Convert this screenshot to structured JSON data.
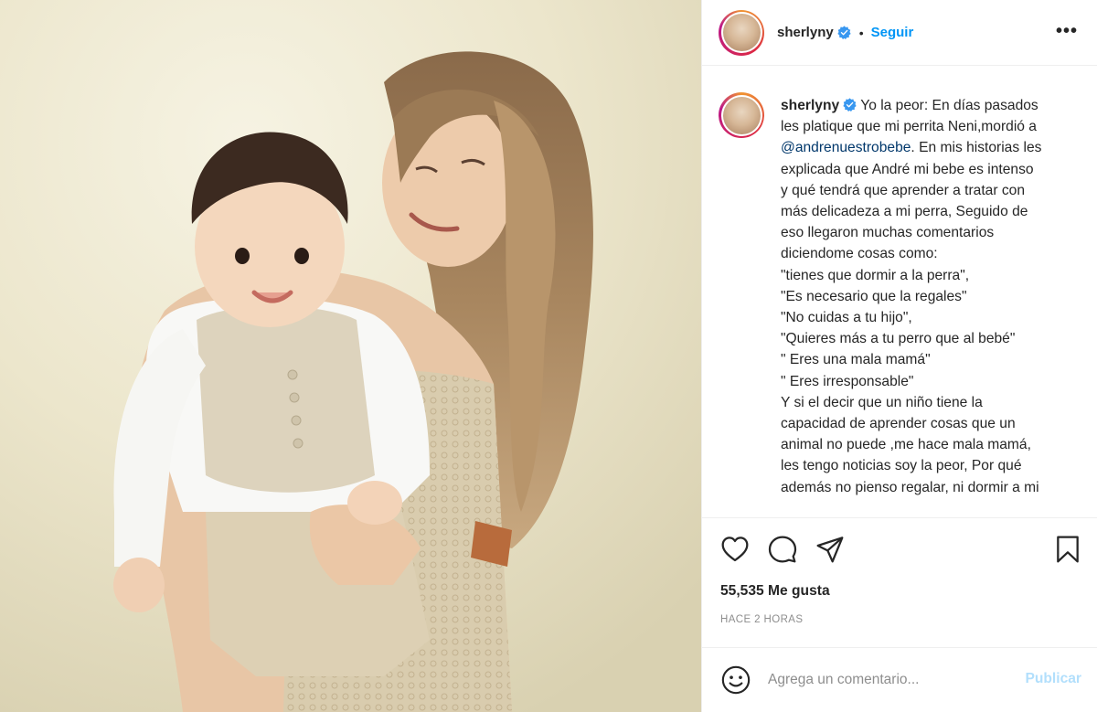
{
  "post": {
    "username": "sherlyny",
    "follow_label": "Seguir",
    "separator": "•",
    "more_label": "•••",
    "caption_username": "sherlyny",
    "caption_lines": [
      "Yo la peor: En días pasados",
      "les platique que mi perrita Neni,mordió a",
      "@andrenuestrobebe",
      ". En mis historias les",
      "explicada que André mi bebe es intenso",
      "y qué tendrá que aprender a tratar con",
      "más delicadeza a mi perra, Seguido de",
      "eso llegaron muchas comentarios",
      "diciendome cosas como:",
      "\"tienes que dormir a la perra\",",
      "\"Es necesario que la regales\"",
      "\"No cuidas a tu hijo\",",
      "\"Quieres más a tu perro que al bebé\"",
      "\" Eres una mala mamá\"",
      "\" Eres irresponsable\"",
      "Y si el decir que un niño tiene la",
      "capacidad de aprender cosas que un",
      "animal no puede ,me hace mala mamá,",
      "les tengo noticias soy la peor, Por qué",
      "además no pienso regalar, ni dormir a mi"
    ],
    "likes": "55,535 Me gusta",
    "timestamp": "HACE 2 HORAS",
    "comment_placeholder": "Agrega un comentario...",
    "publish_label": "Publicar"
  },
  "icons": {
    "verified": "verified-badge-icon",
    "like": "heart-icon",
    "comment": "comment-icon",
    "share": "paper-plane-icon",
    "save": "bookmark-icon",
    "emoji": "emoji-icon",
    "more": "more-options-icon"
  },
  "colors": {
    "accent": "#0095f6",
    "verified": "#3897f0",
    "mention": "#00376b",
    "muted": "#8e8e8e",
    "publish_disabled": "#b2dffc",
    "border": "#efefef"
  }
}
